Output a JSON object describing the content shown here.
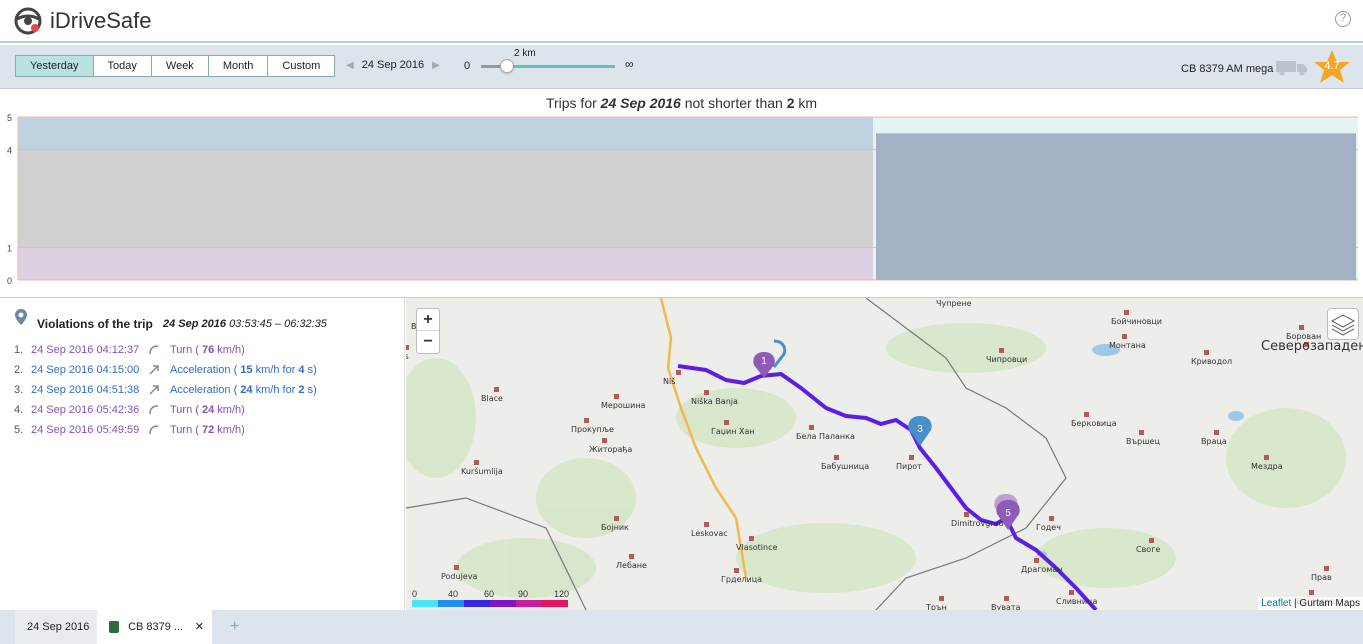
{
  "app": {
    "title": "iDriveSafe",
    "help": "?"
  },
  "toolbar": {
    "periods": [
      "Yesterday",
      "Today",
      "Week",
      "Month",
      "Custom"
    ],
    "active_period": "Yesterday",
    "date": "24 Sep 2016",
    "slider": {
      "min": "0",
      "max": "∞",
      "value_label": "2 km",
      "value_fraction": 0.18
    },
    "vehicle": "CB 8379 AM mega",
    "rating": "4.7"
  },
  "chart": {
    "title_prefix": "Trips for",
    "title_date": "24 Sep 2016",
    "title_mid": "not shorter than",
    "title_value": "2",
    "title_unit": "km",
    "y_ticks": [
      "0",
      "1",
      "4",
      "5"
    ]
  },
  "chart_data": {
    "type": "bar",
    "ylim": [
      0,
      5
    ],
    "y_ticks": [
      0,
      1,
      4,
      5
    ],
    "bands": [
      {
        "from": 0,
        "to": 1,
        "color": "#dcd0e3"
      },
      {
        "from": 1,
        "to": 4,
        "color": "#d0d0d0"
      },
      {
        "from": 4,
        "to": 5,
        "color": "#bfd2df"
      }
    ],
    "bars": [
      {
        "label": "",
        "value": 4.5
      }
    ]
  },
  "violations": {
    "title": "Violations of the trip",
    "trip_date": "24 Sep 2016",
    "trip_time": "03:53:45 – 06:32:35",
    "items": [
      {
        "num": "1.",
        "time": "24 Sep 2016 04:12:37",
        "kind": "turn",
        "label": "Turn (",
        "val": "76",
        "unit": "km/h)",
        "extra": "",
        "extra_val": "",
        "extra_unit": ""
      },
      {
        "num": "2.",
        "time": "24 Sep 2016 04:15:00",
        "kind": "acc",
        "label": "Acceleration (",
        "val": "15",
        "unit": "km/h for",
        "extra": "",
        "extra_val": "4",
        "extra_unit": "s)"
      },
      {
        "num": "3.",
        "time": "24 Sep 2016 04:51:38",
        "kind": "acc",
        "label": "Acceleration (",
        "val": "24",
        "unit": "km/h for",
        "extra": "",
        "extra_val": "2",
        "extra_unit": "s)"
      },
      {
        "num": "4.",
        "time": "24 Sep 2016 05:42:36",
        "kind": "turn",
        "label": "Turn (",
        "val": "24",
        "unit": "km/h)",
        "extra": "",
        "extra_val": "",
        "extra_unit": ""
      },
      {
        "num": "5.",
        "time": "24 Sep 2016 05:49:59",
        "kind": "turn",
        "label": "Turn (",
        "val": "72",
        "unit": "km/h)",
        "extra": "",
        "extra_val": "",
        "extra_unit": ""
      }
    ]
  },
  "map": {
    "zoom_in": "+",
    "zoom_out": "−",
    "attribution_link": "Leaflet",
    "attribution_text": "| Gurtam Maps",
    "legend_ticks": [
      "0",
      "40",
      "60",
      "90",
      "120"
    ],
    "markers": [
      "1",
      "3",
      "5"
    ],
    "places": [
      "Чупрене",
      "Бойчиновци",
      "Монтана",
      "Кривoдол",
      "Борован",
      "Северозападен",
      "Чипровци",
      "Берковица",
      "Вършец",
      "Враца",
      "Мездра",
      "Годеч",
      "Своге",
      "Ботевград",
      "Драгоман",
      "Сливница",
      "Трън",
      "Бабушница",
      "Пирот",
      "Бела Паланка",
      "Niš",
      "Niška Banja",
      "Гаџин Хан",
      "Мерошина",
      "Прокупље",
      "Житорађа",
      "Blace",
      "Kuršumlija",
      "Бојник",
      "Leskovac",
      "Vlasotince",
      "Лебане",
      "Грделица",
      "Podujeva",
      "Dimitrovgrad",
      "Вац",
      "Зrus",
      "Вувата",
      "Прав"
    ]
  },
  "tabs": {
    "date_tab": "24 Sep 2016",
    "vehicle_tab": "CB 8379 ...",
    "close": "✕",
    "add": "+"
  }
}
